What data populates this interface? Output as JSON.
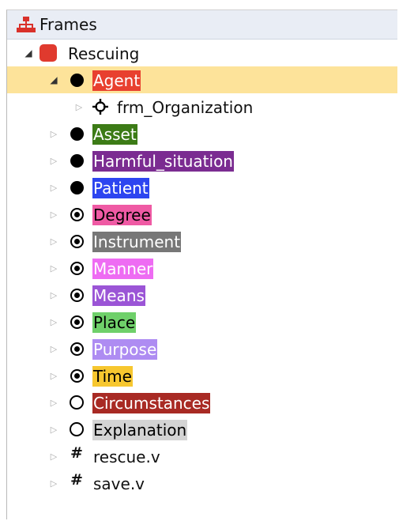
{
  "tree": {
    "header": {
      "label": "Frames",
      "icon": "hierarchy-icon",
      "icon_color": "#d9312b"
    },
    "root": {
      "label": "Rescuing",
      "icon": "red-square-icon",
      "icon_color": "#e03a2e"
    },
    "selected": "Agent",
    "elements": [
      {
        "label": "Agent",
        "marker": "filled-circle",
        "bg": "#e8402f",
        "fg": "#ffffff",
        "expanded": true,
        "children": [
          {
            "label": "frm_Organization",
            "icon": "crosshair-icon"
          }
        ]
      },
      {
        "label": "Asset",
        "marker": "filled-circle",
        "bg": "#3c7b16",
        "fg": "#ffffff"
      },
      {
        "label": "Harmful_situation",
        "marker": "filled-circle",
        "bg": "#7b2c91",
        "fg": "#ffffff"
      },
      {
        "label": "Patient",
        "marker": "filled-circle",
        "bg": "#2d45f0",
        "fg": "#ffffff"
      },
      {
        "label": "Degree",
        "marker": "target-circle",
        "bg": "#ef5aa4",
        "fg": "#000000"
      },
      {
        "label": "Instrument",
        "marker": "target-circle",
        "bg": "#777777",
        "fg": "#ffffff"
      },
      {
        "label": "Manner",
        "marker": "target-circle",
        "bg": "#ee6cf3",
        "fg": "#ffffff"
      },
      {
        "label": "Means",
        "marker": "target-circle",
        "bg": "#9b55d6",
        "fg": "#ffffff"
      },
      {
        "label": "Place",
        "marker": "target-circle",
        "bg": "#6fd06a",
        "fg": "#000000"
      },
      {
        "label": "Purpose",
        "marker": "target-circle",
        "bg": "#ae8cf2",
        "fg": "#ffffff"
      },
      {
        "label": "Time",
        "marker": "target-circle",
        "bg": "#f7c72f",
        "fg": "#000000"
      },
      {
        "label": "Circumstances",
        "marker": "empty-circle",
        "bg": "#a82a24",
        "fg": "#ffffff"
      },
      {
        "label": "Explanation",
        "marker": "empty-circle",
        "bg": "#d4d4d4",
        "fg": "#000000"
      }
    ],
    "lexical_units": [
      {
        "label": "rescue.v",
        "icon": "hash-icon"
      },
      {
        "label": "save.v",
        "icon": "hash-icon"
      }
    ]
  }
}
